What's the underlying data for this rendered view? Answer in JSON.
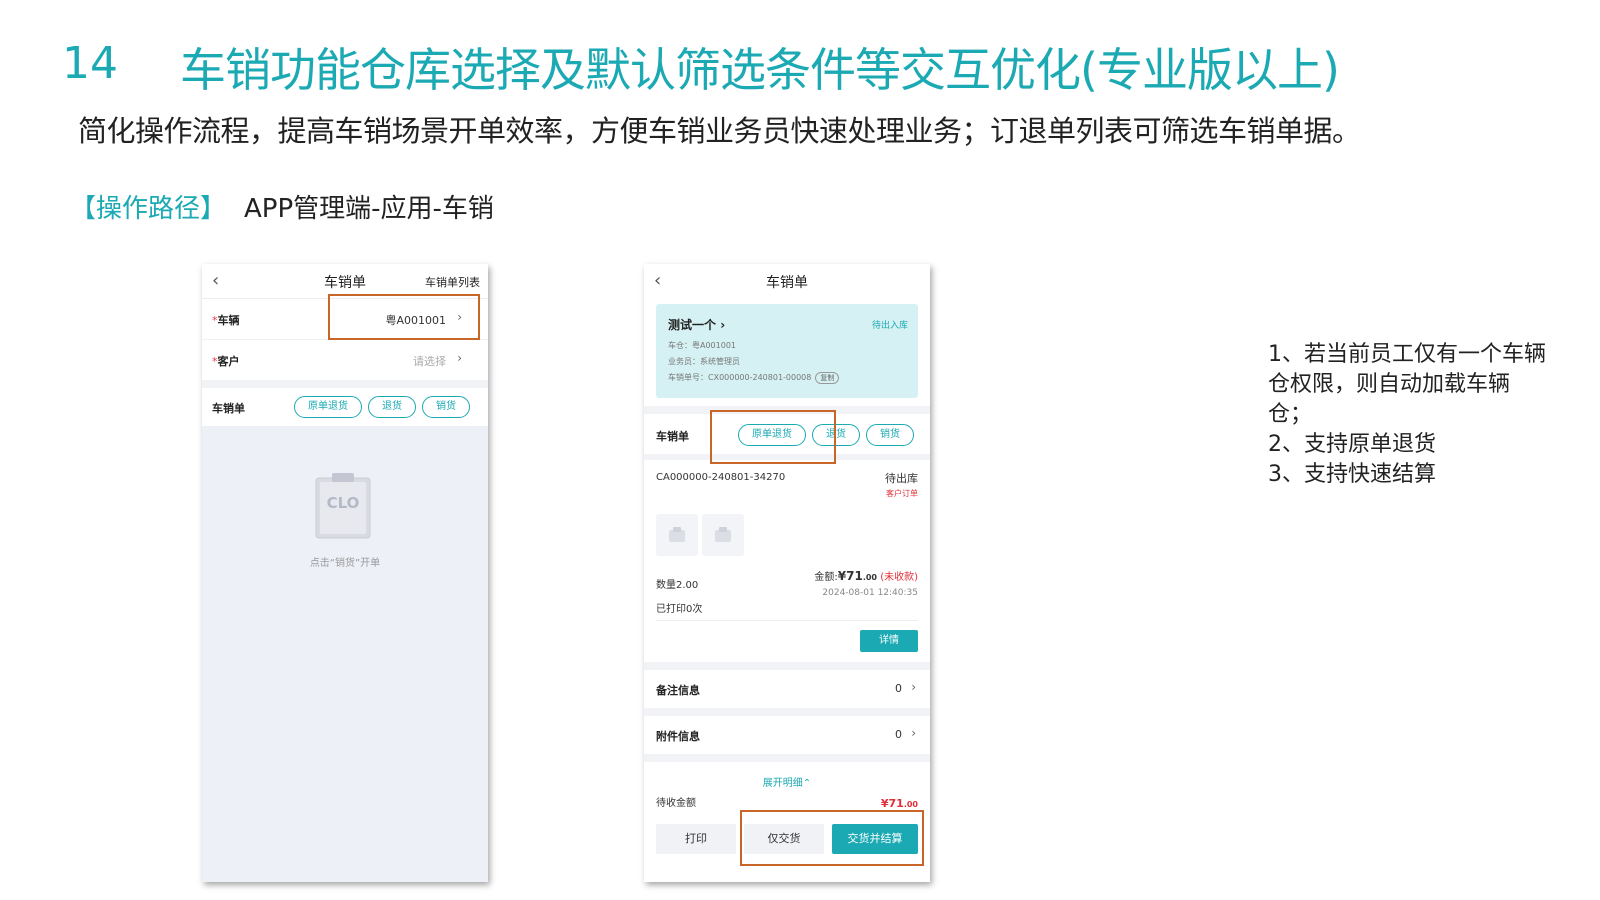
{
  "slide": {
    "number": "14",
    "title": "车销功能仓库选择及默认筛选条件等交互优化(专业版以上)",
    "subtitle": "简化操作流程，提高车销场景开单效率，方便车销业务员快速处理业务；订退单列表可筛选车销单据。",
    "path_label": "【操作路径】",
    "path_value": "APP管理端-应用-车销",
    "notes": [
      "1、若当前员工仅有一个车辆仓权限，则自动加载车辆仓；",
      "2、支持原单退货",
      "3、支持快速结算"
    ],
    "highlight_color": "#c8662a",
    "accent_color": "#1ba9b3"
  },
  "phone1": {
    "back_icon": "chevron-left-icon",
    "title": "车销单",
    "right_link": "车销单列表",
    "vehicle": {
      "required": "*",
      "label": "车辆",
      "value": "粤A001001"
    },
    "customer": {
      "required": "*",
      "label": "客户",
      "placeholder": "请选择"
    },
    "order_section": {
      "label": "车销单",
      "btn_original_return": "原单退货",
      "btn_return": "退货",
      "btn_sale": "销货"
    },
    "empty": {
      "icon": "clipboard-icon",
      "icon_text": "CLO",
      "hint": "点击“销货”开单"
    }
  },
  "phone2": {
    "back_icon": "chevron-left-icon",
    "title": "车销单",
    "card": {
      "customer_name": "测试一个",
      "status": "待出入库",
      "warehouse": "车仓：粤A001001",
      "salesperson": "业务员：系统管理员",
      "order_no": "车销单号：CX000000-240801-00008",
      "copy": "复制"
    },
    "order_section": {
      "label": "车销单",
      "btn_original_return": "原单退货",
      "btn_return": "退货",
      "btn_sale": "销货"
    },
    "order": {
      "number": "CA000000-240801-34270",
      "status": "待出库",
      "tag": "客户订单",
      "quantity": "数量2.00",
      "printed": "已打印0次",
      "amount_label": "金额:",
      "amount_int": "¥71",
      "amount_dec": ".00",
      "amount_state": "(未收款)",
      "datetime": "2024-08-01 12:40:35",
      "detail_btn": "详情"
    },
    "remarks": {
      "label": "备注信息",
      "count": "0"
    },
    "attachments": {
      "label": "附件信息",
      "count": "0"
    },
    "expand": "展开明细",
    "receivable": {
      "label": "待收金额",
      "amount_int": "¥71",
      "amount_dec": ".00"
    },
    "buttons": {
      "print": "打印",
      "deliver_only": "仅交货",
      "deliver_settle": "交货并结算"
    }
  }
}
